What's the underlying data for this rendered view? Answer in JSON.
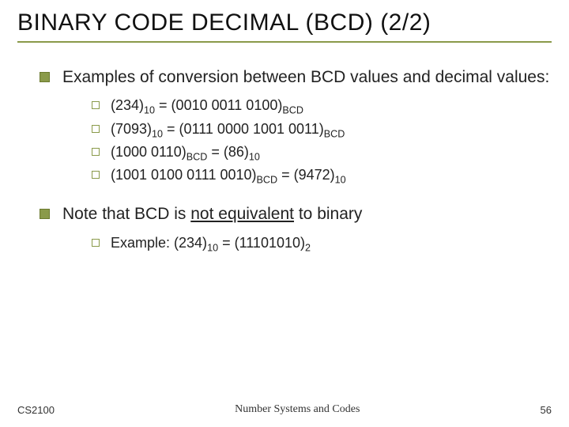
{
  "title": "BINARY CODE DECIMAL (BCD) (2/2)",
  "b1": {
    "text": "Examples of conversion between BCD values and decimal values:",
    "items": {
      "i0": {
        "a": "(234)",
        "as": "10",
        "eq": " = (0010 0011 0100)",
        "bs": "BCD",
        "tail": ""
      },
      "i1": {
        "a": "(7093)",
        "as": "10",
        "eq": " = (0111 0000 1001 0011)",
        "bs": "BCD",
        "tail": ""
      },
      "i2": {
        "a": "(1000 0110)",
        "as": "BCD",
        "eq": " = (86)",
        "bs": "10",
        "tail": ""
      },
      "i3": {
        "a": "(1001 0100 0111 0010)",
        "as": "BCD",
        "eq": " = (9472)",
        "bs": "10",
        "tail": ""
      }
    }
  },
  "b2": {
    "pre": "Note that BCD is ",
    "u": "not equivalent",
    "post": " to binary",
    "items": {
      "i0": {
        "pre": "Example: (234)",
        "as": "10",
        "mid": " = (11101010)",
        "bs": "2"
      }
    }
  },
  "footer": {
    "left": "CS2100",
    "center": "Number Systems and Codes",
    "right": "56"
  }
}
